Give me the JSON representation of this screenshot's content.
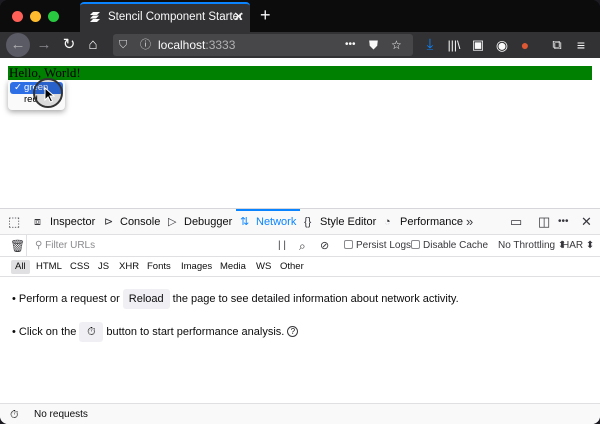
{
  "browser": {
    "tab_title": "Stencil Component Starter",
    "tab_close": "✕",
    "new_tab": "+",
    "url_host": "localhost",
    "url_port": ":3333",
    "url_more": "•••"
  },
  "page": {
    "heading": "Hello, World!",
    "select_options": [
      {
        "label": "green",
        "selected": true
      },
      {
        "label": "red",
        "selected": false
      }
    ],
    "colors": {
      "heading_bg": "#008000"
    }
  },
  "devtools": {
    "tabs": [
      {
        "label": "Inspector",
        "icon": "inspector-icon"
      },
      {
        "label": "Console",
        "icon": "console-icon"
      },
      {
        "label": "Debugger",
        "icon": "debugger-icon"
      },
      {
        "label": "Network",
        "icon": "network-icon",
        "active": true
      },
      {
        "label": "Style Editor",
        "icon": "style-editor-icon"
      },
      {
        "label": "Performance",
        "icon": "performance-icon"
      }
    ],
    "overflow": "»",
    "close": "✕",
    "filter_placeholder": "Filter URLs",
    "pause": "| |",
    "persist_logs": "Persist Logs",
    "disable_cache": "Disable Cache",
    "throttling": "No Throttling ⬍",
    "har": "HAR ⬍",
    "types": [
      "All",
      "HTML",
      "CSS",
      "JS",
      "XHR",
      "Fonts",
      "Images",
      "Media",
      "WS",
      "Other"
    ],
    "msg1_pre": "• Perform a request or",
    "msg1_button": "Reload",
    "msg1_post": "the page to see detailed information about network activity.",
    "msg2_pre": "• Click on the",
    "msg2_post": "button to start performance analysis.",
    "status": "No requests",
    "accent": "#0a84ff"
  }
}
